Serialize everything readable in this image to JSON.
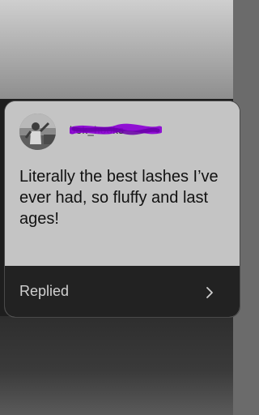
{
  "review_card": {
    "username": "bek_hooks",
    "review_text": "Literally the best lashes I’ve ever had, so fluffy and last ages!",
    "footer": {
      "status_label": "Replied",
      "icon": "chevron-right-icon"
    },
    "avatar_icon": "user-avatar-icon",
    "redaction_color": "#8b00d4"
  }
}
